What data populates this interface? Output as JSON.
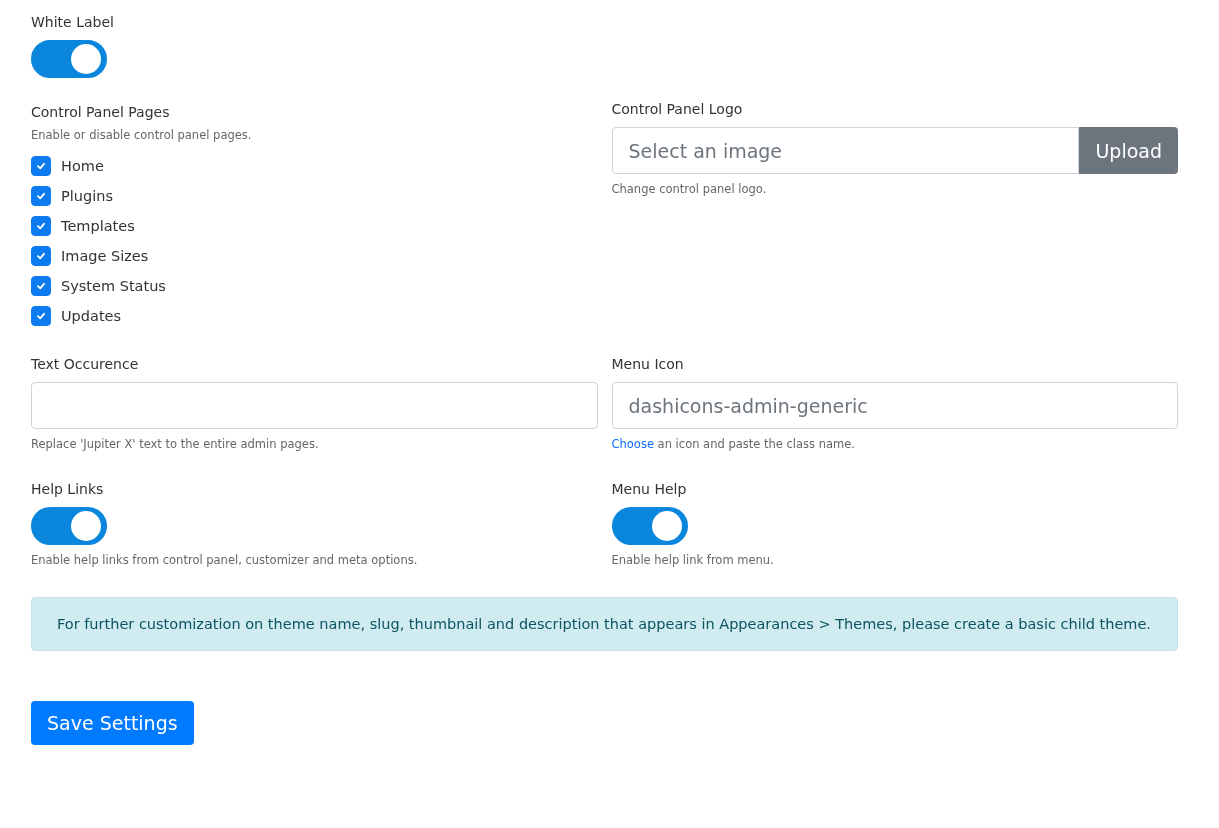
{
  "white_label": {
    "label": "White Label",
    "on": true
  },
  "control_panel_pages": {
    "label": "Control Panel Pages",
    "help": "Enable or disable control panel pages.",
    "pages": [
      {
        "label": "Home",
        "checked": true
      },
      {
        "label": "Plugins",
        "checked": true
      },
      {
        "label": "Templates",
        "checked": true
      },
      {
        "label": "Image Sizes",
        "checked": true
      },
      {
        "label": "System Status",
        "checked": true
      },
      {
        "label": "Updates",
        "checked": true
      }
    ]
  },
  "control_panel_logo": {
    "label": "Control Panel Logo",
    "placeholder": "Select an image",
    "button": "Upload",
    "help": "Change control panel logo."
  },
  "text_occurence": {
    "label": "Text Occurence",
    "help": "Replace 'Jupiter X' text to the entire admin pages."
  },
  "menu_icon": {
    "label": "Menu Icon",
    "placeholder": "dashicons-admin-generic",
    "help_link": "Choose",
    "help": "an icon and paste the class name."
  },
  "help_links": {
    "label": "Help Links",
    "on": true,
    "help": "Enable help links from control panel, customizer and meta options."
  },
  "menu_help": {
    "label": "Menu Help",
    "on": true,
    "help": "Enable help link from menu."
  },
  "notice": "For further customization on theme name, slug, thumbnail and description that appears in Appearances > Themes, please create a basic child theme.",
  "save_button": "Save Settings"
}
